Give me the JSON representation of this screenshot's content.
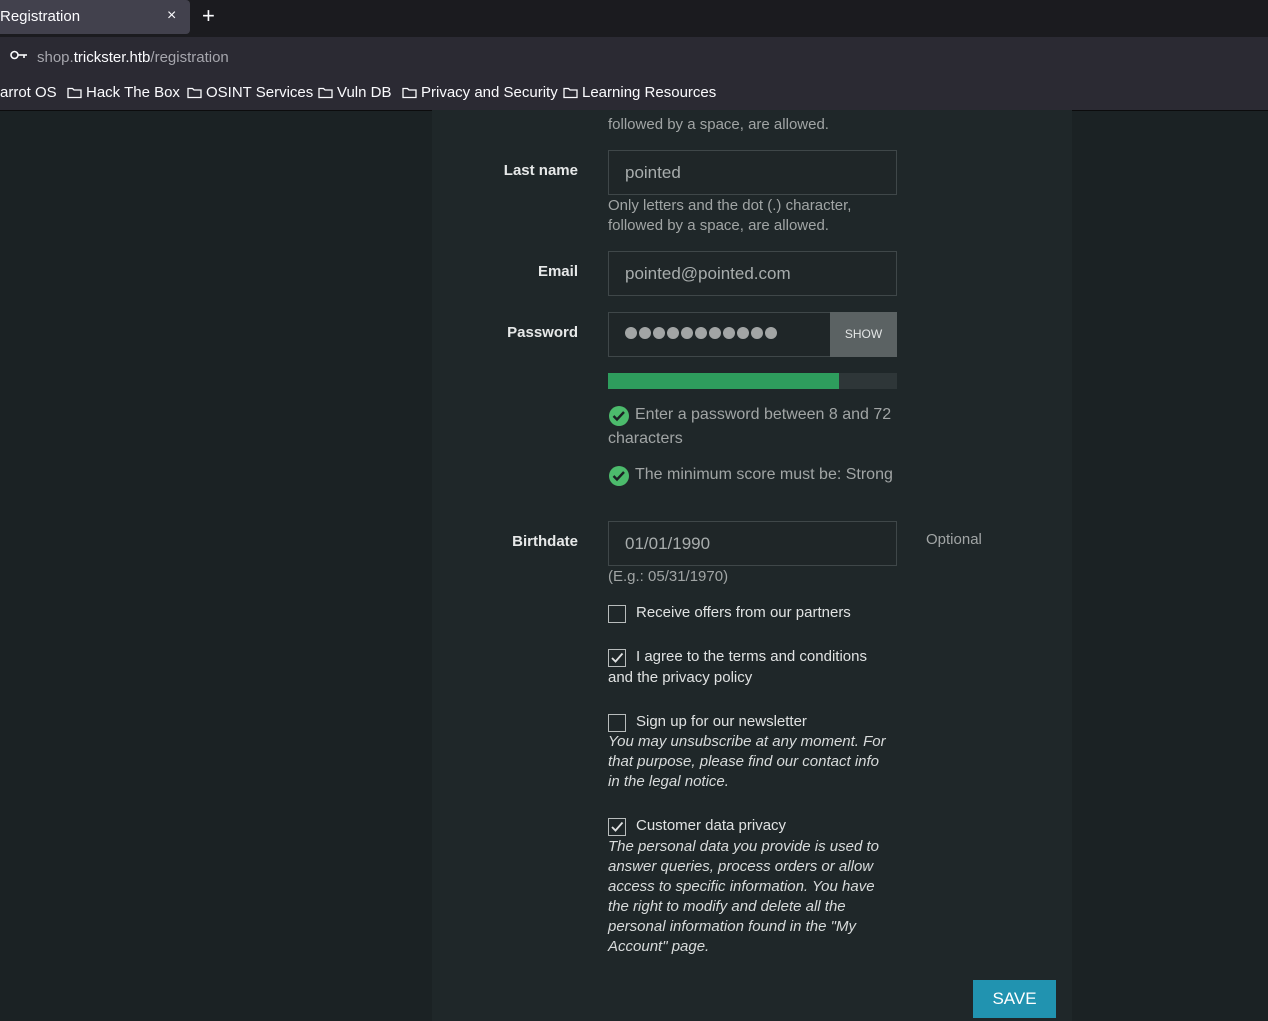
{
  "browser": {
    "tab_title": "Registration",
    "tab_close": "×",
    "new_tab": "+",
    "url_prefix": "shop.",
    "url_host": "trickster.htb",
    "url_path": "/registration",
    "bookmarks": [
      "arrot OS",
      "Hack The Box",
      "OSINT Services",
      "Vuln DB",
      "Privacy and Security",
      "Learning Resources"
    ]
  },
  "form": {
    "first_name_hint_tail": "followed by a space, are allowed.",
    "last_name": {
      "label": "Last name",
      "value": "pointed",
      "hint_line1": "Only letters and the dot (.) character,",
      "hint_line2": "followed by a space, are allowed."
    },
    "email": {
      "label": "Email",
      "value": "pointed@pointed.com"
    },
    "password": {
      "label": "Password",
      "masked_length": 11,
      "show_label": "SHOW",
      "strength_fraction": 0.8,
      "rule1_line1": "Enter a password between 8 and 72",
      "rule1_line2": "characters",
      "rule2": "The minimum score must be: Strong"
    },
    "birthdate": {
      "label": "Birthdate",
      "value": "01/01/1990",
      "example": "(E.g.: 05/31/1970)",
      "optional": "Optional"
    },
    "checkboxes": {
      "partners": {
        "label": "Receive offers from our partners",
        "checked": false
      },
      "terms": {
        "label_line1": "I agree to the terms and conditions",
        "label_line2": "and the privacy policy",
        "checked": true
      },
      "newsletter": {
        "label": "Sign up for our newsletter",
        "checked": false,
        "note_line1": "You may unsubscribe at any moment. For",
        "note_line2": "that purpose, please find our contact info",
        "note_line3": "in the legal notice."
      },
      "privacy": {
        "label": "Customer data privacy",
        "checked": true,
        "note_line1": "The personal data you provide is used to",
        "note_line2": "answer queries, process orders or allow",
        "note_line3": "access to specific information. You have",
        "note_line4": "the right to modify and delete all the",
        "note_line5": "personal information found in the \"My",
        "note_line6": "Account\" page."
      }
    },
    "save_label": "SAVE"
  },
  "colors": {
    "accent": "#2193b0",
    "strength": "#2e9d5d",
    "check": "#4cbb6c",
    "background": "#1b2224"
  }
}
